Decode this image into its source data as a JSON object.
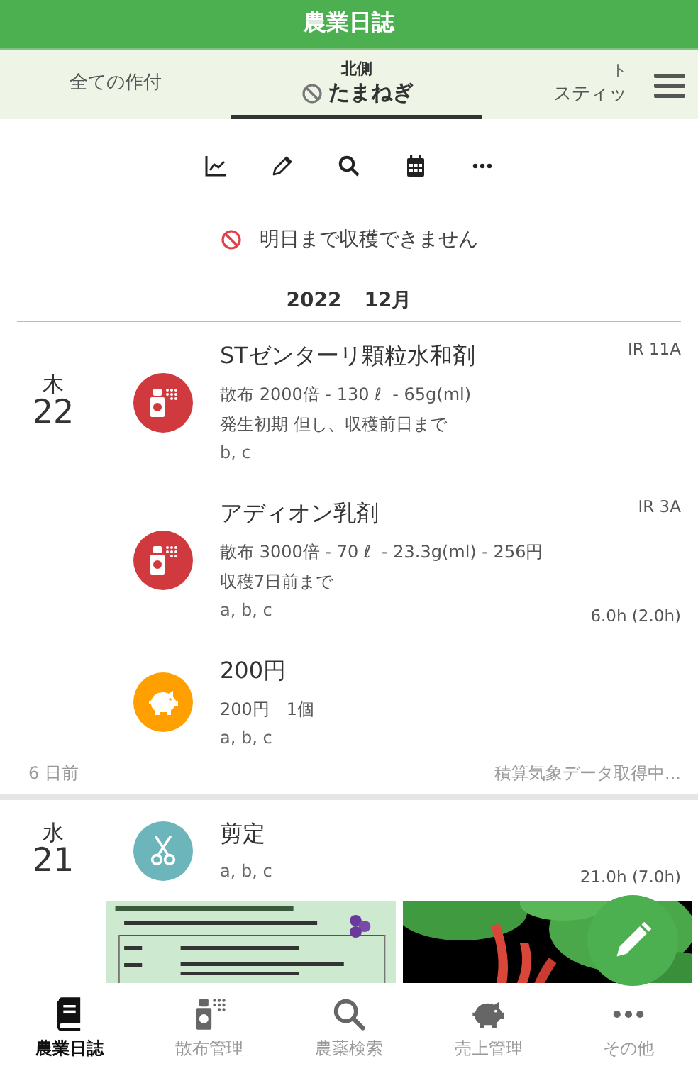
{
  "header": {
    "title": "農業日誌"
  },
  "crop_tabs": [
    {
      "label": "全ての作付",
      "selected": false,
      "blocked": false
    },
    {
      "field": "北側",
      "label": "たまねぎ",
      "selected": true,
      "blocked": true
    },
    {
      "field": "ト",
      "label": "スティッ",
      "selected": false,
      "blocked": false
    }
  ],
  "notice": {
    "text": "明日まで収穫できません"
  },
  "month": {
    "year": "2022",
    "month": "12月"
  },
  "days": [
    {
      "weekday": "木",
      "day": "22",
      "entries": [
        {
          "kind": "spray",
          "title": "STゼンターリ顆粒水和剤",
          "code": "IR 11A",
          "lines": [
            "散布 2000倍 - 130 ℓ  - 65g(ml)",
            "発生初期 但し、収穫前日まで"
          ],
          "tags": "b, c"
        },
        {
          "kind": "spray",
          "title": "アディオン乳剤",
          "code": "IR 3A",
          "lines": [
            "散布 3000倍 - 70 ℓ  - 23.3g(ml) - 256円",
            "収穫7日前まで"
          ],
          "tags": "a, b, c",
          "hours": "6.0h (2.0h)"
        },
        {
          "kind": "sales",
          "title": "200円",
          "lines": [
            "200円　1個"
          ],
          "tags": "a, b, c"
        }
      ],
      "ago": "6 日前",
      "weather": "積算気象データ取得中..."
    },
    {
      "weekday": "水",
      "day": "21",
      "entries": [
        {
          "kind": "prune",
          "title": "剪定",
          "tags": "a, b, c",
          "hours": "21.0h (7.0h)"
        }
      ]
    }
  ],
  "nav": [
    {
      "kind": "diary",
      "label": "農業日誌",
      "selected": true
    },
    {
      "kind": "spray",
      "label": "散布管理",
      "selected": false
    },
    {
      "kind": "search",
      "label": "農薬検索",
      "selected": false
    },
    {
      "kind": "sales",
      "label": "売上管理",
      "selected": false
    },
    {
      "kind": "more",
      "label": "その他",
      "selected": false
    }
  ]
}
